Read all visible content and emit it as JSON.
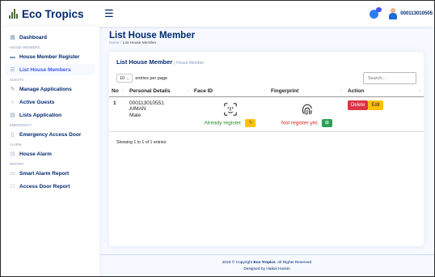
{
  "brand": {
    "name": "Eco Tropics"
  },
  "header": {
    "user_id": "000113010505"
  },
  "sidebar": {
    "dashboard": "Dashboard",
    "sec_house_members": "HOUSE MEMBERS",
    "house_member_register": "House Member Register",
    "list_house_members": "List House Members",
    "sec_guests": "GUESTS",
    "manage_applications": "Manage Applications",
    "active_guests": "Active Guests",
    "lists_application": "Lists Application",
    "sec_emergency": "EMERGENCY",
    "emergency_access_door": "Emergency Access Door",
    "sec_alarm": "ALARM",
    "house_alarm": "House Alarm",
    "sec_report": "REPORT",
    "smart_alarm_report": "Smart Alarm Report",
    "access_door_report": "Access Door Report"
  },
  "page": {
    "title": "List House Member",
    "breadcrumb_home": "Home",
    "breadcrumb_sep": " / ",
    "breadcrumb_current": "List House Member"
  },
  "card": {
    "title": "List House Member",
    "subtitle": "| House Member"
  },
  "table_controls": {
    "entries_value": "10",
    "entries_label": "entries per page",
    "search_placeholder": "Search..."
  },
  "table": {
    "headers": [
      "No",
      "Personal Details",
      "Face ID",
      "Fingerprint",
      "Action"
    ],
    "rows": [
      {
        "no": "1",
        "id": "000113010551",
        "name": "AIMAN",
        "gender": "Male",
        "face_status": "Already register.",
        "fingerprint_status": "Not register yet.",
        "delete_label": "Delete",
        "edit_label": "Edit"
      }
    ],
    "info": "Showing 1 to 1 of 1 entries"
  },
  "footer": {
    "copyright_prefix": "2023 © Copyright ",
    "copyright_brand": "Eco Tropics",
    "copyright_suffix": ". All Rights Reserved",
    "designed_by": "Designed by Haikal Hussin"
  },
  "colors": {
    "primary": "#4154f1",
    "navy": "#012970",
    "danger": "#dc3545",
    "warning": "#ffc107",
    "success": "#2e9d57"
  }
}
